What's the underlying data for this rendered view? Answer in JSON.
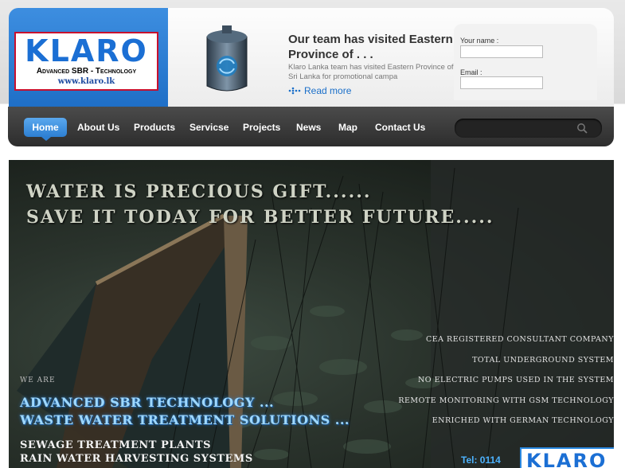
{
  "logo": {
    "wordmark": "KLARO",
    "tagline": "Advanced SBR - Technology",
    "url": "www.klaro.lk"
  },
  "news": {
    "title": "Our team has visited Eastern Province of . . .",
    "excerpt": "Klaro Lanka team has visited Eastern Province of Sri Lanka for promotional campa",
    "read_more": "Read more"
  },
  "form": {
    "name_label": "Your name :",
    "email_label": "Email :"
  },
  "nav": {
    "items": [
      "Home",
      "About Us",
      "Products",
      "Servicse",
      "Projects",
      "News",
      "Map",
      "Contact Us"
    ]
  },
  "banner": {
    "headline_1": "WATER IS PRECIOUS GIFT......",
    "headline_2": "SAVE IT TODAY FOR BETTER FUTURE.....",
    "features": [
      "CEA REGISTERED CONSULTANT COMPANY",
      "TOTAL UNDERGROUND SYSTEM",
      "NO ELECTRIC PUMPS USED IN THE SYSTEM",
      "REMOTE MONITORING WITH GSM TECHNOLOGY",
      "ENRICHED WITH GERMAN TECHNOLOGY"
    ],
    "we_are": "WE ARE",
    "tech_1": "ADVANCED SBR TECHNOLOGY ...",
    "tech_2": "WASTE WATER TREATMENT SOLUTIONS ...",
    "service_1": "SEWAGE TREATMENT PLANTS",
    "service_2": "RAIN WATER HARVESTING SYSTEMS",
    "tel": "Tel: 0114",
    "mini_logo": "KLARO"
  },
  "colors": {
    "accent": "#2d7fd2",
    "nav_bg": "#333333",
    "logo_red": "#c8102e"
  }
}
